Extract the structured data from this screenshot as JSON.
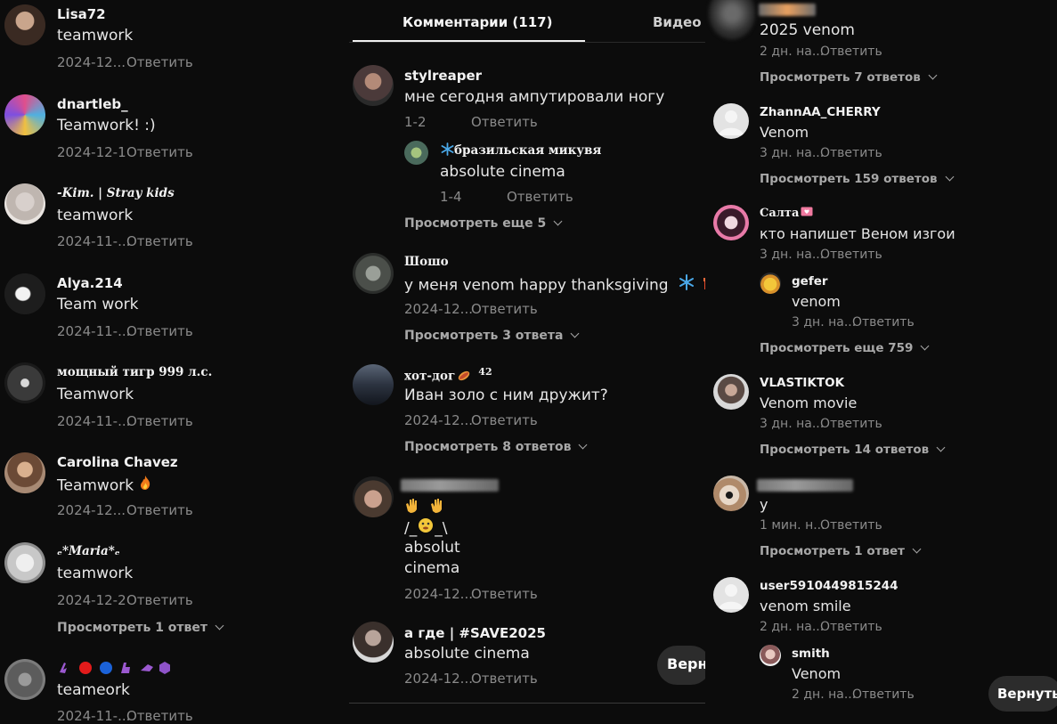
{
  "left": {
    "comments": [
      {
        "user": "Lisa72",
        "text": "teamwork",
        "date": "2024-12...",
        "reply": "Ответить"
      },
      {
        "user": "dnartleb_",
        "text": "Teamwork! :)",
        "date": "2024-12-1",
        "reply": "Ответить"
      },
      {
        "user": "-𝑲𝒊𝒎. | 𝑺𝒕𝒓𝒂𝒚 𝒌𝒊𝒅𝒔",
        "text": "teamwork",
        "date": "2024-11-...",
        "reply": "Ответить"
      },
      {
        "user": "Alya.214",
        "text": "Team work",
        "date": "2024-11-...",
        "reply": "Ответить"
      },
      {
        "user": "мощный тигр 999 л.с.",
        "text": "Teamwork",
        "date": "2024-11-...",
        "reply": "Ответить"
      },
      {
        "user": "Carolina Chavez",
        "text": "Teamwork",
        "date": "2024-12...",
        "reply": "Ответить"
      },
      {
        "user": "ₑ*𝑴𝒂𝒓𝒊𝒂*ₑ",
        "text": "teamwork",
        "date": "2024-12-2",
        "reply": "Ответить",
        "more": "Просмотреть 1 ответ"
      },
      {
        "user": "",
        "text": "teameork",
        "date": "2024-11-...",
        "reply": "Ответить"
      }
    ]
  },
  "mid": {
    "tabs": [
      {
        "label": "Комментарии (117)",
        "active": true
      },
      {
        "label": "Видео а"
      }
    ],
    "c1": {
      "user": "stylreaper",
      "text": "мне сегодня ампутировали ногу",
      "date": "1-2",
      "reply": "Ответить",
      "sub": {
        "user": "бразильская микувя",
        "text": "absolute cinema",
        "date": "1-4",
        "reply": "Ответить"
      },
      "more": "Просмотреть еще 5"
    },
    "c2": {
      "user": "Шошо",
      "text": "у меня venom happy thanksgiving",
      "date": "2024-12...",
      "reply": "Ответить",
      "more": "Просмотреть 3 ответа"
    },
    "c3": {
      "user": "хот-дог",
      "user_suffix": "42",
      "text": "Иван золо с ним дружит?",
      "date": "2024-12...",
      "reply": "Ответить",
      "more": "Просмотреть 8 ответов"
    },
    "c4": {
      "text1": "/_",
      "text1b": "_\\",
      "text2": "absolut",
      "text3": "cinema",
      "date": "2024-12...",
      "reply": "Ответить"
    },
    "c5": {
      "user": "а где | #SAVE2025",
      "text": "absolute cinema",
      "date": "2024-12...",
      "reply": "Ответить"
    },
    "back": "Верн"
  },
  "right": {
    "c0": {
      "text": "2025 venom",
      "date": "2 дн. на...",
      "reply": "Ответить",
      "more": "Просмотреть 7 ответов"
    },
    "c1": {
      "user": "ZhannAA_CHERRY",
      "text": "Venom",
      "date": "3 дн. на...",
      "reply": "Ответить",
      "more": "Просмотреть 159 ответов"
    },
    "c2": {
      "user": "Салта",
      "text": "кто напишет Веном изгои",
      "date": "3 дн. на...",
      "reply": "Ответить",
      "sub": {
        "user": "gefer",
        "text": "venom",
        "date": "3 дн. на...",
        "reply": "Ответить"
      },
      "more": "Просмотреть еще 759"
    },
    "c3": {
      "user": "VLASTIKTOK",
      "text": "Venom movie",
      "date": "3 дн. на...",
      "reply": "Ответить",
      "more": "Просмотреть 14 ответов"
    },
    "c4": {
      "text": "у",
      "date": "1 мин. н...",
      "reply": "Ответить",
      "more": "Просмотреть 1 ответ"
    },
    "c5": {
      "user": "user5910449815244",
      "text": "venom smile",
      "date": "2 дн. на...",
      "reply": "Ответить",
      "sub": {
        "user": "smith",
        "text": "Venom",
        "date": "2 дн. на...",
        "reply": "Ответить"
      }
    },
    "back": "Вернуть"
  }
}
